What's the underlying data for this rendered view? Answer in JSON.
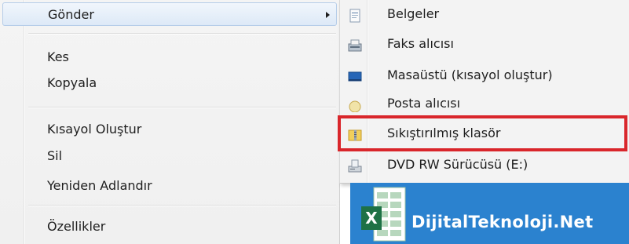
{
  "context_menu": {
    "items": [
      {
        "label": "Gönder"
      },
      {
        "label": "Kes"
      },
      {
        "label": "Kopyala"
      },
      {
        "label": "Kısayol Oluştur"
      },
      {
        "label": "Sil"
      },
      {
        "label": "Yeniden Adlandır"
      },
      {
        "label": "Özellikler"
      }
    ]
  },
  "send_to_submenu": {
    "items": [
      {
        "label": "Belgeler",
        "icon": "documents-icon"
      },
      {
        "label": "Faks alıcısı",
        "icon": "fax-icon"
      },
      {
        "label": "Masaüstü (kısayol oluştur)",
        "icon": "desktop-icon"
      },
      {
        "label": "Posta alıcısı",
        "icon": "mail-icon"
      },
      {
        "label": "Sıkıştırılmış klasör",
        "icon": "zip-folder-icon"
      },
      {
        "label": "DVD RW Sürücüsü (E:)",
        "icon": "dvd-drive-icon"
      }
    ]
  },
  "banner": {
    "text": "DijitalTeknoloji.Net",
    "icon": "excel-logo-icon"
  },
  "colors": {
    "highlight": "#d9262b",
    "banner": "#2b82cf",
    "hover": "#dde9f7"
  }
}
